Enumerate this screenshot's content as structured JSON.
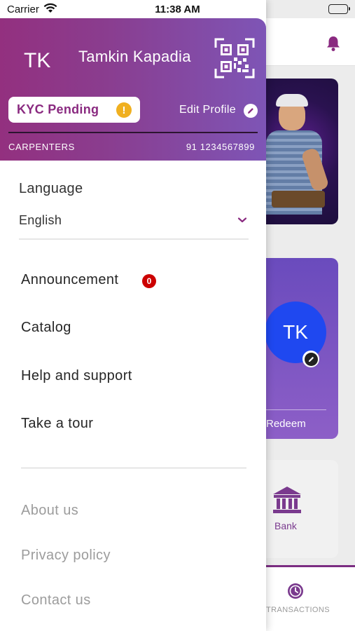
{
  "status_bar": {
    "carrier": "Carrier",
    "time": "11:38 AM"
  },
  "background": {
    "avatar_initials": "TK",
    "redeem_label": "Redeem",
    "bank_label": "Bank",
    "transactions_label": "TRANSACTIONS"
  },
  "drawer": {
    "header": {
      "initials": "TK",
      "name": "Tamkin Kapadia",
      "kyc_status": "KYC Pending",
      "kyc_warning_symbol": "!",
      "edit_profile_label": "Edit Profile",
      "profession": "CARPENTERS",
      "phone": "91 1234567899"
    },
    "language": {
      "title": "Language",
      "selected": "English"
    },
    "menu": {
      "announcement": "Announcement",
      "announcement_count": "0",
      "catalog": "Catalog",
      "help": "Help and support",
      "tour": "Take a tour"
    },
    "secondary_menu": {
      "about": "About us",
      "privacy": "Privacy policy",
      "contact": "Contact us"
    }
  },
  "colors": {
    "brand_purple": "#8a2a80",
    "header_gradient_start": "#93307f",
    "header_gradient_end": "#7e55b6",
    "kyc_warning": "#f0b020",
    "badge_red": "#cc0000",
    "avatar_blue": "#1f48f0"
  },
  "icons": [
    "wifi-icon",
    "battery-icon",
    "bell-icon",
    "qr-code-icon",
    "warning-icon",
    "pencil-icon",
    "chevron-down-icon",
    "bank-icon",
    "transactions-icon"
  ]
}
